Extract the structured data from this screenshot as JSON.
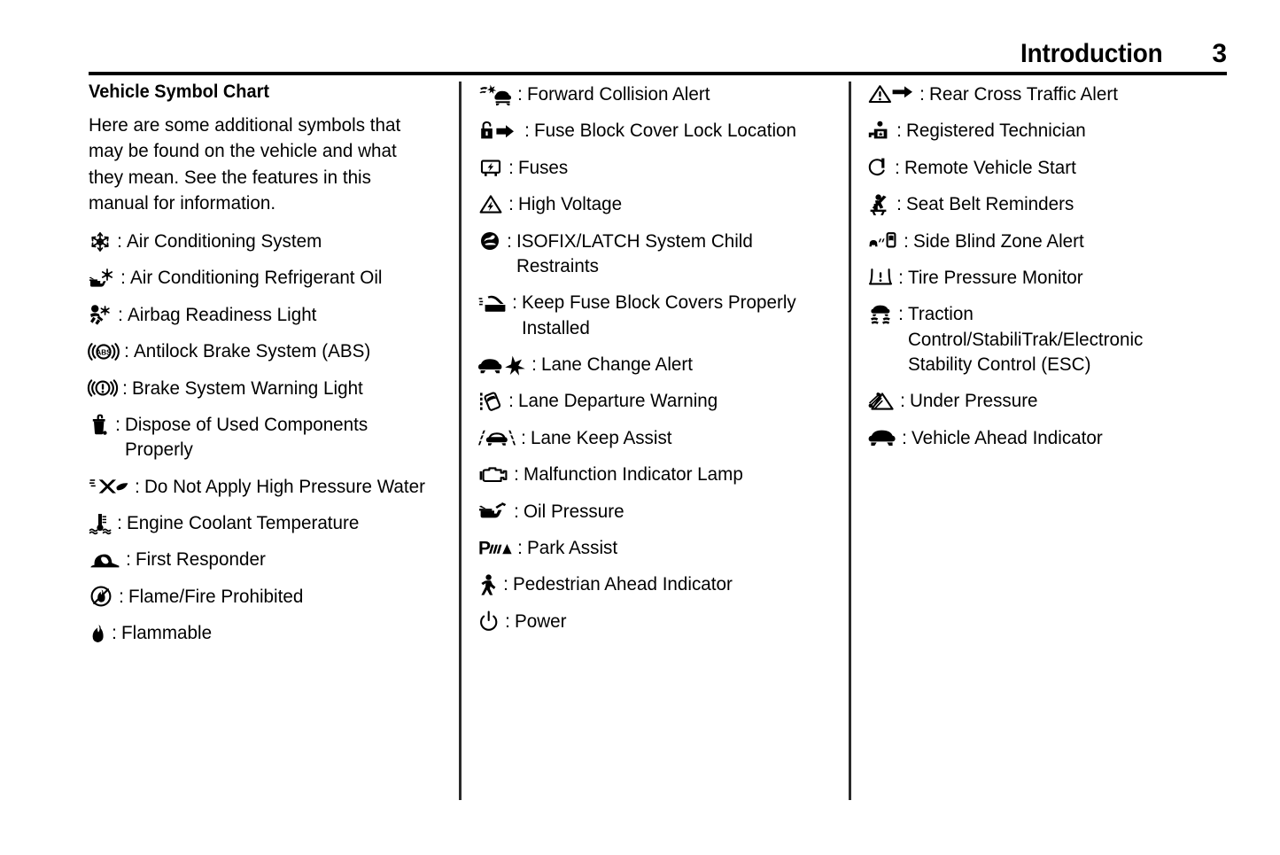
{
  "header": {
    "title": "Introduction",
    "page_number": "3"
  },
  "section": {
    "title": "Vehicle Symbol Chart",
    "intro": "Here are some additional symbols that may be found on the vehicle and what they mean. See the features in this manual for information."
  },
  "separator": ":",
  "columns": [
    {
      "id": "column-1",
      "entries": [
        {
          "icon": "snowflake-icon",
          "label": "Air Conditioning System"
        },
        {
          "icon": "refrigerant-oil-icon",
          "label": "Air Conditioning Refrigerant Oil"
        },
        {
          "icon": "airbag-readiness-icon",
          "label": "Airbag Readiness Light"
        },
        {
          "icon": "abs-icon",
          "label": "Antilock Brake System (ABS)"
        },
        {
          "icon": "brake-warning-icon",
          "label": "Brake System Warning Light"
        },
        {
          "icon": "dispose-properly-icon",
          "label": "Dispose of Used Components Properly"
        },
        {
          "icon": "no-high-pressure-water-icon",
          "label": "Do Not Apply High Pressure Water"
        },
        {
          "icon": "coolant-temperature-icon",
          "label": "Engine Coolant Temperature"
        },
        {
          "icon": "first-responder-icon",
          "label": "First Responder"
        },
        {
          "icon": "no-flame-icon",
          "label": "Flame/Fire Prohibited"
        },
        {
          "icon": "flammable-icon",
          "label": "Flammable"
        }
      ]
    },
    {
      "id": "column-2",
      "entries": [
        {
          "icon": "forward-collision-alert-icon",
          "label": "Forward Collision Alert"
        },
        {
          "icon": "fuse-block-lock-icon",
          "label": "Fuse Block Cover Lock Location"
        },
        {
          "icon": "fuses-icon",
          "label": "Fuses"
        },
        {
          "icon": "high-voltage-icon",
          "label": "High Voltage"
        },
        {
          "icon": "isofix-latch-icon",
          "label": "ISOFIX/LATCH System Child Restraints"
        },
        {
          "icon": "keep-fuse-covers-icon",
          "label": "Keep Fuse Block Covers Properly Installed"
        },
        {
          "icon": "lane-change-alert-icon",
          "label": "Lane Change Alert"
        },
        {
          "icon": "lane-departure-warning-icon",
          "label": "Lane Departure Warning"
        },
        {
          "icon": "lane-keep-assist-icon",
          "label": "Lane Keep Assist"
        },
        {
          "icon": "malfunction-indicator-icon",
          "label": "Malfunction Indicator Lamp"
        },
        {
          "icon": "oil-pressure-icon",
          "label": "Oil Pressure"
        },
        {
          "icon": "park-assist-icon",
          "label": "Park Assist"
        },
        {
          "icon": "pedestrian-ahead-icon",
          "label": "Pedestrian Ahead Indicator"
        },
        {
          "icon": "power-icon",
          "label": "Power"
        }
      ]
    },
    {
      "id": "column-3",
      "entries": [
        {
          "icon": "rear-cross-traffic-alert-icon",
          "label": "Rear Cross Traffic Alert"
        },
        {
          "icon": "registered-technician-icon",
          "label": "Registered Technician"
        },
        {
          "icon": "remote-vehicle-start-icon",
          "label": "Remote Vehicle Start"
        },
        {
          "icon": "seat-belt-reminder-icon",
          "label": "Seat Belt Reminders"
        },
        {
          "icon": "side-blind-zone-alert-icon",
          "label": "Side Blind Zone Alert"
        },
        {
          "icon": "tire-pressure-monitor-icon",
          "label": "Tire Pressure Monitor"
        },
        {
          "icon": "traction-control-icon",
          "label": "Traction Control/StabiliTrak/Electronic Stability Control (ESC)"
        },
        {
          "icon": "under-pressure-icon",
          "label": "Under Pressure"
        },
        {
          "icon": "vehicle-ahead-indicator-icon",
          "label": "Vehicle Ahead Indicator"
        }
      ]
    }
  ]
}
